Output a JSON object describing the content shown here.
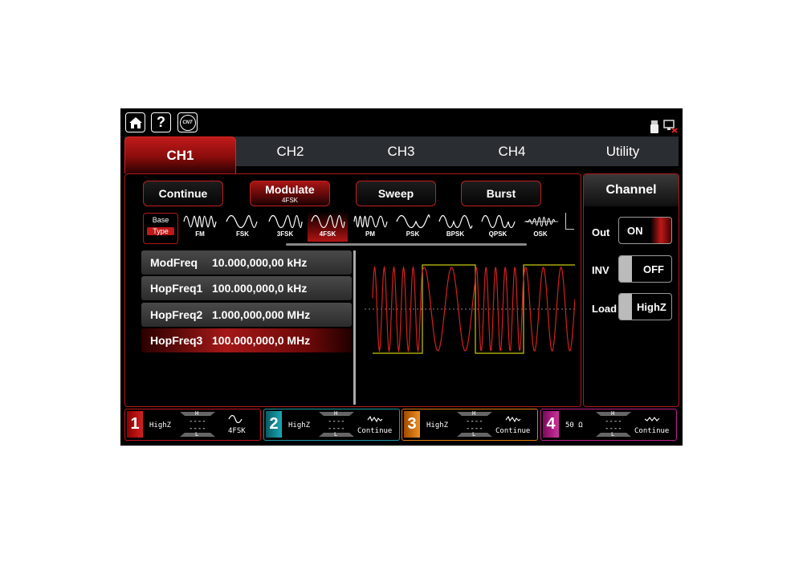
{
  "top_icons": [
    "home-icon",
    "help-icon",
    "counter-icon"
  ],
  "counter_label": "CNT",
  "status_icons": [
    "usb-icon",
    "network-disconnected-icon"
  ],
  "tabs": [
    {
      "label": "CH1",
      "active": true
    },
    {
      "label": "CH2",
      "active": false
    },
    {
      "label": "CH3",
      "active": false
    },
    {
      "label": "CH4",
      "active": false
    },
    {
      "label": "Utility",
      "active": false
    }
  ],
  "modes": {
    "continue": "Continue",
    "modulate": "Modulate",
    "modulate_sub": "4FSK",
    "sweep": "Sweep",
    "burst": "Burst"
  },
  "base_type": {
    "base": "Base",
    "type": "Type"
  },
  "mod_types": [
    "FM",
    "FSK",
    "3FSK",
    "4FSK",
    "PM",
    "PSK",
    "BPSK",
    "QPSK",
    "OSK"
  ],
  "selected_mod": "4FSK",
  "params": [
    {
      "label": "ModFreq",
      "value": "10.000,000,00 kHz"
    },
    {
      "label": "HopFreq1",
      "value": "100.000,000,0 kHz"
    },
    {
      "label": "HopFreq2",
      "value": "1.000,000,000 MHz"
    },
    {
      "label": "HopFreq3",
      "value": "100.000,000,0 MHz"
    }
  ],
  "channel_panel": {
    "title": "Channel",
    "out_label": "Out",
    "out_value": "ON",
    "inv_label": "INV",
    "inv_value": "OFF",
    "load_label": "Load",
    "load_value": "HighZ"
  },
  "channel_bar": [
    {
      "num": "1",
      "load": "HighZ",
      "mode": "4FSK",
      "color": "#c0151a",
      "h": "H",
      "l": "L",
      "dash": "----"
    },
    {
      "num": "2",
      "load": "HighZ",
      "mode": "Continue",
      "color": "#1a9aa8",
      "h": "H",
      "l": "L",
      "dash": "----"
    },
    {
      "num": "3",
      "load": "HighZ",
      "mode": "Continue",
      "color": "#e07a10",
      "h": "H",
      "l": "L",
      "dash": "----"
    },
    {
      "num": "4",
      "load": "50 Ω",
      "mode": "Continue",
      "color": "#c0208c",
      "h": "H",
      "l": "L",
      "dash": "----"
    }
  ],
  "colors": {
    "accent": "#b01818",
    "wave": "#d42020",
    "mod_wave": "#c8c810"
  }
}
